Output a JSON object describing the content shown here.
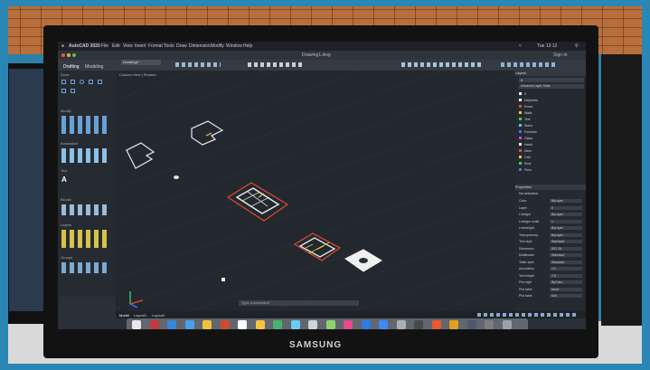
{
  "app": {
    "name": "AutoCAD 2020",
    "menus": [
      "File",
      "Edit",
      "View",
      "Insert",
      "Format",
      "Tools",
      "Draw",
      "Dimension",
      "Modify",
      "Window",
      "Help"
    ],
    "clock": "Tue 12:12",
    "sign_in": "Sign In",
    "document_title": "Drawing1.dwg",
    "workspace_tabs": [
      "Drafting",
      "Modeling"
    ],
    "doc_tab": "Drawing1*",
    "view_labels": [
      "Custom View",
      "Shaded"
    ],
    "command_placeholder": "Type a command",
    "model_tabs": [
      "Model",
      "Layout1",
      "Layout2"
    ]
  },
  "palette": {
    "sections": [
      "Draw",
      "Modify",
      "Annotation",
      "Text",
      "Blocks",
      "Layers",
      "Groups"
    ]
  },
  "layers_panel": {
    "title": "Layers",
    "current_layer": "0",
    "dropdown": "Unsaved Layer State",
    "layer_rows": [
      "0",
      "Defpoints",
      "Doors",
      "Walls",
      "Text",
      "Stairs",
      "Furniture",
      "Glass",
      "Hatch",
      "Dims",
      "Grid",
      "Roof",
      "Floor"
    ]
  },
  "properties_panel": {
    "title": "Properties",
    "header": "No selection",
    "rows": [
      {
        "label": "Color",
        "value": "ByLayer"
      },
      {
        "label": "Layer",
        "value": "0"
      },
      {
        "label": "Linetype",
        "value": "ByLayer"
      },
      {
        "label": "Linetype scale",
        "value": "1"
      },
      {
        "label": "Lineweight",
        "value": "ByLayer"
      },
      {
        "label": "Transparency",
        "value": "ByLayer"
      },
      {
        "label": "Text style",
        "value": "Standard"
      },
      {
        "label": "Dimension",
        "value": "ISO-25"
      },
      {
        "label": "Multileader",
        "value": "Standard"
      },
      {
        "label": "Table style",
        "value": "Standard"
      },
      {
        "label": "Annotation",
        "value": "1:1"
      },
      {
        "label": "Text height",
        "value": "2.5"
      },
      {
        "label": "Plot style",
        "value": "ByColor"
      },
      {
        "label": "Plot table",
        "value": "None"
      },
      {
        "label": "Plot table",
        "value": "N/A"
      }
    ]
  },
  "viewcube_label": "SE",
  "monitor_brand": "SAMSUNG",
  "dock_colors": [
    "#e8e8e8",
    "#c23b3b",
    "#3a86d9",
    "#4aa0e8",
    "#f0c040",
    "#d04b2b",
    "#ffffff",
    "#f5c542",
    "#47b36b",
    "#6acdf0",
    "#cfd4da",
    "#8dd36c",
    "#e44b8a",
    "#2f7ae5",
    "#3d8af7",
    "#aab0b8",
    "#4a4a4a",
    "#e65c2e",
    "#e0a020",
    "#4d5a6b",
    "#7d7d7d",
    "#9aa3ad"
  ]
}
